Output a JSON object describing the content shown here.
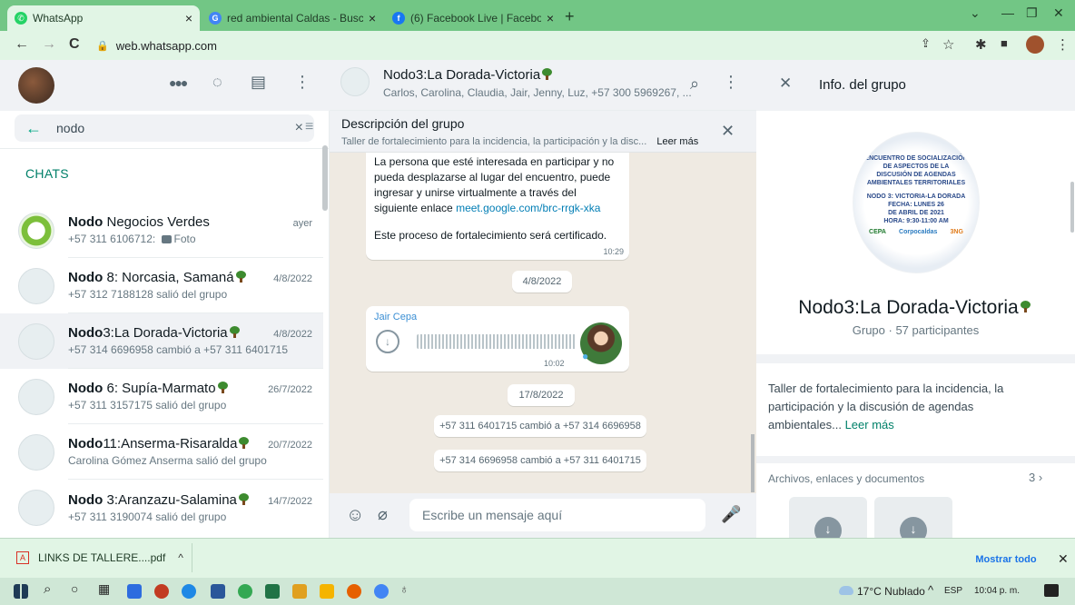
{
  "browser": {
    "tabs": [
      {
        "title": "WhatsApp"
      },
      {
        "title": "red ambiental Caldas - Buscar co"
      },
      {
        "title": "(6) Facebook Live | Facebook"
      }
    ],
    "new_tab": "+",
    "url": "web.whatsapp.com"
  },
  "search": {
    "query": "nodo"
  },
  "chats_label": "CHATS",
  "chats": [
    {
      "bold": "Nodo",
      "rest": " Negocios Verdes",
      "tree": false,
      "date": "ayer",
      "sub_prefix": "+57 311 6106712: ",
      "sub_icon": "camera-icon",
      "sub_text": "Foto"
    },
    {
      "bold": "Nodo",
      "rest": " 8: Norcasia, Samaná",
      "tree": true,
      "date": "4/8/2022",
      "sub_prefix": "",
      "sub_text": "+57 312 7188128 salió del grupo"
    },
    {
      "bold": "Nodo",
      "rest": "3:La Dorada-Victoria",
      "tree": true,
      "date": "4/8/2022",
      "sub_prefix": "",
      "sub_text": "+57 314 6696958 cambió a +57 311 6401715"
    },
    {
      "bold": "Nodo",
      "rest": " 6: Supía-Marmato",
      "tree": true,
      "date": "26/7/2022",
      "sub_prefix": "",
      "sub_text": "+57 311 3157175 salió del grupo"
    },
    {
      "bold": "Nodo",
      "rest": "11:Anserma-Risaralda",
      "tree": true,
      "date": "20/7/2022",
      "sub_prefix": "",
      "sub_text": "Carolina Gómez Anserma salió del grupo"
    },
    {
      "bold": "Nodo",
      "rest": " 3:Aranzazu-Salamina",
      "tree": true,
      "date": "14/7/2022",
      "sub_prefix": "",
      "sub_text": "+57 311 3190074 salió del grupo"
    }
  ],
  "conversation": {
    "title": "Nodo3:La Dorada-Victoria",
    "members": "Carlos, Carolina, Claudia, Jair, Jenny, Luz, +57 300 5969267, ...",
    "desc_title": "Descripción del grupo",
    "desc_text": "Taller de fortalecimiento para la incidencia, la participación y la disc...",
    "desc_more": "Leer más",
    "msg1_lines": [
      "La persona que esté interesada en participar y no",
      "pueda desplazarse al lugar del encuentro, puede",
      "ingresar y unirse virtualmente a través del"
    ],
    "msg1_link_prefix": "siguiente enlace ",
    "msg1_link": "meet.google.com/brc-rrgk-xka",
    "msg1_cert": "Este proceso de fortalecimiento será certificado.",
    "msg1_time": "10:29",
    "date_chip1": "4/8/2022",
    "voice_sender": "Jair Cepa",
    "voice_time": "10:02",
    "date_chip2": "17/8/2022",
    "sys1": "+57 311 6401715 cambió a +57 314 6696958",
    "sys2": "+57 314 6696958 cambió a +57 311 6401715",
    "compose_placeholder": "Escribe un mensaje aquí"
  },
  "info": {
    "header": "Info. del grupo",
    "poster_lines": [
      "ENCUENTRO DE SOCIALIZACIÓN",
      "DE ASPECTOS DE LA",
      "DISCUSIÓN DE AGENDAS",
      "AMBIENTALES TERRITORIALES",
      "NODO 3: VICTORIA-LA DORADA",
      "FECHA: LUNES 26",
      "DE ABRIL DE 2021",
      "HORA: 9:30-11:00 AM"
    ],
    "poster_logos": [
      "CEPA",
      "Corpocaldas",
      "3NG"
    ],
    "group_name": "Nodo3:La Dorada-Victoria",
    "participants": "Grupo · 57 participantes",
    "desc_lines": [
      "Taller de fortalecimiento para la incidencia, la",
      "participación y la discusión de agendas",
      "ambientales..."
    ],
    "desc_more": "Leer más",
    "files_label": "Archivos, enlaces y documentos",
    "files_count": "3"
  },
  "download": {
    "file": "LINKS DE TALLERE....pdf",
    "show_all": "Mostrar todo"
  },
  "taskbar": {
    "weather": "17°C Nublado",
    "lang": "ESP",
    "time": "10:04 p. m."
  },
  "colors": {
    "accent": "#00a884",
    "accent_dark": "#008069",
    "browser_frame": "#72c685",
    "link": "#027eb5"
  }
}
